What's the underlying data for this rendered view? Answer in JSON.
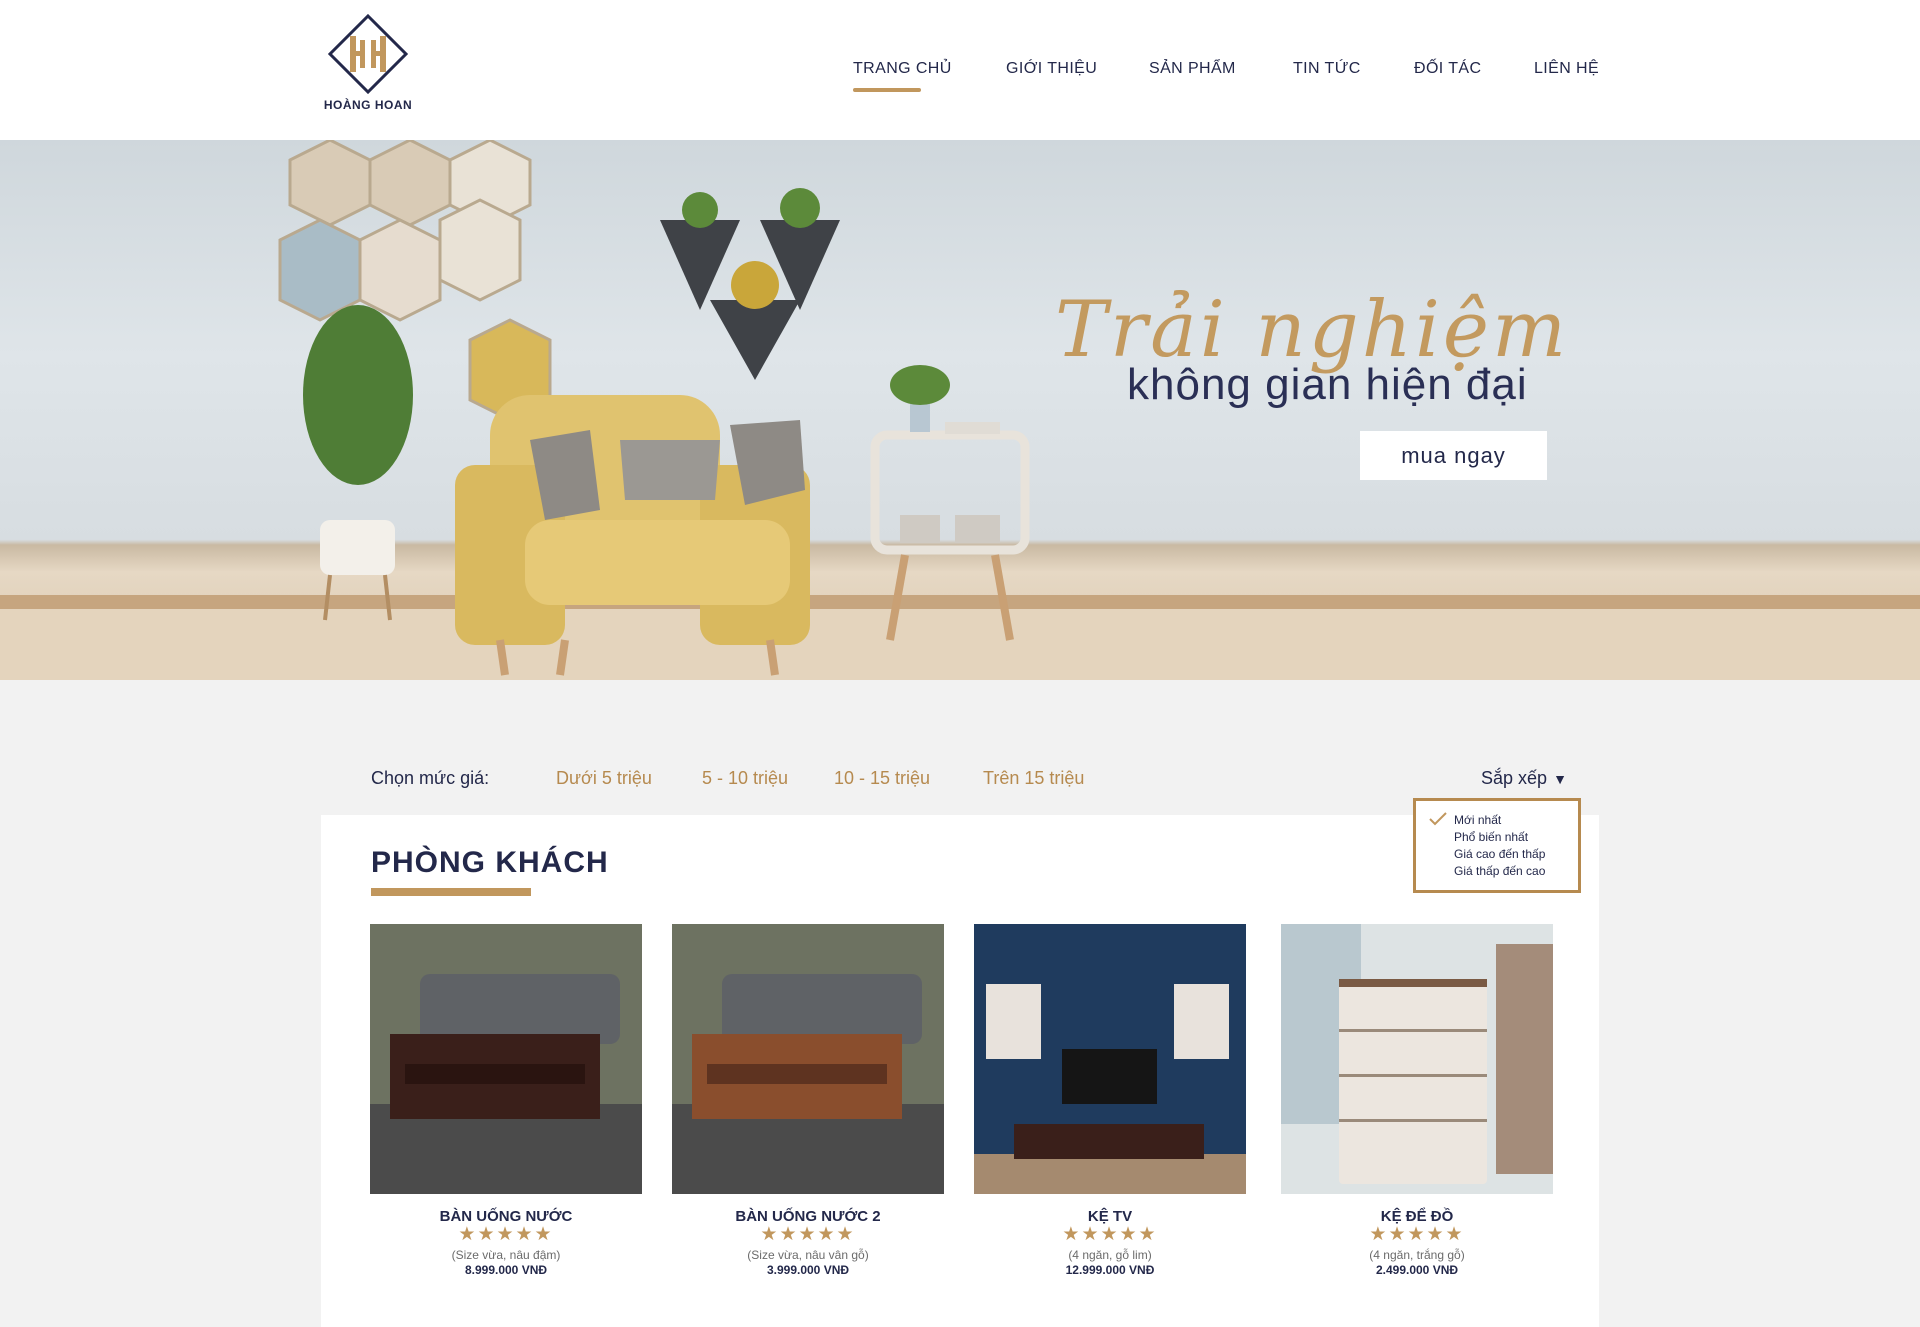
{
  "brand": {
    "name": "HOÀNG HOAN",
    "accent": "#c1975d",
    "navy": "#23284a"
  },
  "nav": {
    "items": [
      {
        "label": "TRANG CHỦ",
        "active": true
      },
      {
        "label": "GIỚI THIỆU"
      },
      {
        "label": "SẢN PHẨM"
      },
      {
        "label": "TIN TỨC"
      },
      {
        "label": "ĐỐI TÁC"
      },
      {
        "label": "LIÊN HỆ"
      }
    ]
  },
  "hero": {
    "script_text": "Trải nghiệm",
    "title": "không gian hiện đại",
    "cta_label": "mua ngay"
  },
  "filters": {
    "label": "Chọn mức giá:",
    "options": [
      "Dưới 5 triệu",
      "5 - 10 triệu",
      "10 - 15 triệu",
      "Trên 15 triệu"
    ],
    "sort_label": "Sắp xếp",
    "sort_options": [
      "Mới nhất",
      "Phổ biến nhất",
      "Giá cao đến thấp",
      "Giá thấp đến cao"
    ],
    "sort_selected": "Mới nhất"
  },
  "section": {
    "title": "PHÒNG KHÁCH"
  },
  "products": [
    {
      "name": "BÀN UỐNG NƯỚC",
      "rating": 5,
      "stars": "★★★★★",
      "desc": "(Size vừa, nâu đậm)",
      "price": "8.999.000 VNĐ"
    },
    {
      "name": "BÀN UỐNG NƯỚC 2",
      "rating": 5,
      "stars": "★★★★★",
      "desc": "(Size vừa, nâu vân gỗ)",
      "price": "3.999.000 VNĐ"
    },
    {
      "name": "KỆ TV",
      "rating": 5,
      "stars": "★★★★★",
      "desc": "(4 ngăn, gỗ lim)",
      "price": "12.999.000 VNĐ"
    },
    {
      "name": "KỆ ĐỂ ĐỒ",
      "rating": 5,
      "stars": "★★★★★",
      "desc": "(4 ngăn, trắng gỗ)",
      "price": "2.499.000 VNĐ"
    }
  ]
}
